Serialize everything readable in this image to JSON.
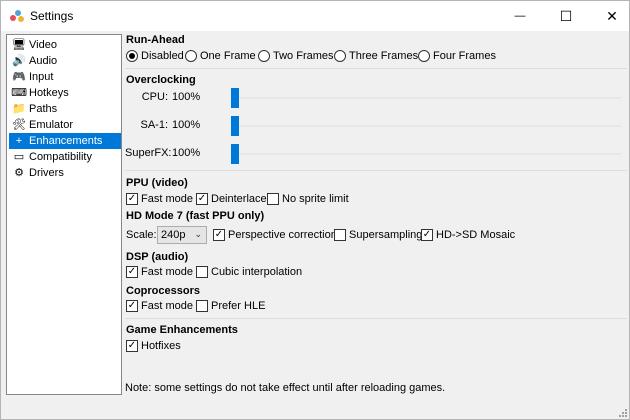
{
  "window": {
    "title": "Settings",
    "controls": {
      "minimize": "—",
      "maximize": "☐",
      "close": "✕"
    }
  },
  "sidebar": {
    "items": [
      {
        "label": "Video",
        "icon": "monitor-icon",
        "glyph": "🖥"
      },
      {
        "label": "Audio",
        "icon": "speaker-icon",
        "glyph": "🔊"
      },
      {
        "label": "Input",
        "icon": "joypad-icon",
        "glyph": "🎮"
      },
      {
        "label": "Hotkeys",
        "icon": "keyboard-icon",
        "glyph": "⌨"
      },
      {
        "label": "Paths",
        "icon": "folder-icon",
        "glyph": "📁"
      },
      {
        "label": "Emulator",
        "icon": "tools-icon",
        "glyph": "🛠"
      },
      {
        "label": "Enhancements",
        "icon": "plus-icon",
        "glyph": "+"
      },
      {
        "label": "Compatibility",
        "icon": "compat-icon",
        "glyph": "▭"
      },
      {
        "label": "Drivers",
        "icon": "gear-icon",
        "glyph": "⚙"
      }
    ],
    "selected_index": 6,
    "selected_color": "#0078d7"
  },
  "runahead": {
    "title": "Run-Ahead",
    "options": [
      "Disabled",
      "One Frame",
      "Two Frames",
      "Three Frames",
      "Four Frames"
    ],
    "selected": 0
  },
  "overclocking": {
    "title": "Overclocking",
    "sliders": [
      {
        "label": "CPU:",
        "value": "100%",
        "position": 0
      },
      {
        "label": "SA-1:",
        "value": "100%",
        "position": 0
      },
      {
        "label": "SuperFX:",
        "value": "100%",
        "position": 0
      }
    ],
    "thumb_color": "#0078d7"
  },
  "ppu": {
    "title": "PPU (video)",
    "checks": [
      {
        "label": "Fast mode",
        "checked": true
      },
      {
        "label": "Deinterlace",
        "checked": true
      },
      {
        "label": "No sprite limit",
        "checked": false
      }
    ]
  },
  "hdmode7": {
    "title": "HD Mode 7 (fast PPU only)",
    "scale_label": "Scale:",
    "scale_value": "240p",
    "checks": [
      {
        "label": "Perspective correction",
        "checked": true
      },
      {
        "label": "Supersampling",
        "checked": false
      },
      {
        "label": "HD->SD Mosaic",
        "checked": true
      }
    ]
  },
  "dsp": {
    "title": "DSP (audio)",
    "checks": [
      {
        "label": "Fast mode",
        "checked": true
      },
      {
        "label": "Cubic interpolation",
        "checked": false
      }
    ]
  },
  "coprocessors": {
    "title": "Coprocessors",
    "checks": [
      {
        "label": "Fast mode",
        "checked": true
      },
      {
        "label": "Prefer HLE",
        "checked": false
      }
    ]
  },
  "game_enhancements": {
    "title": "Game Enhancements",
    "checks": [
      {
        "label": "Hotfixes",
        "checked": true
      }
    ]
  },
  "note": "Note: some settings do not take effect until after reloading games."
}
